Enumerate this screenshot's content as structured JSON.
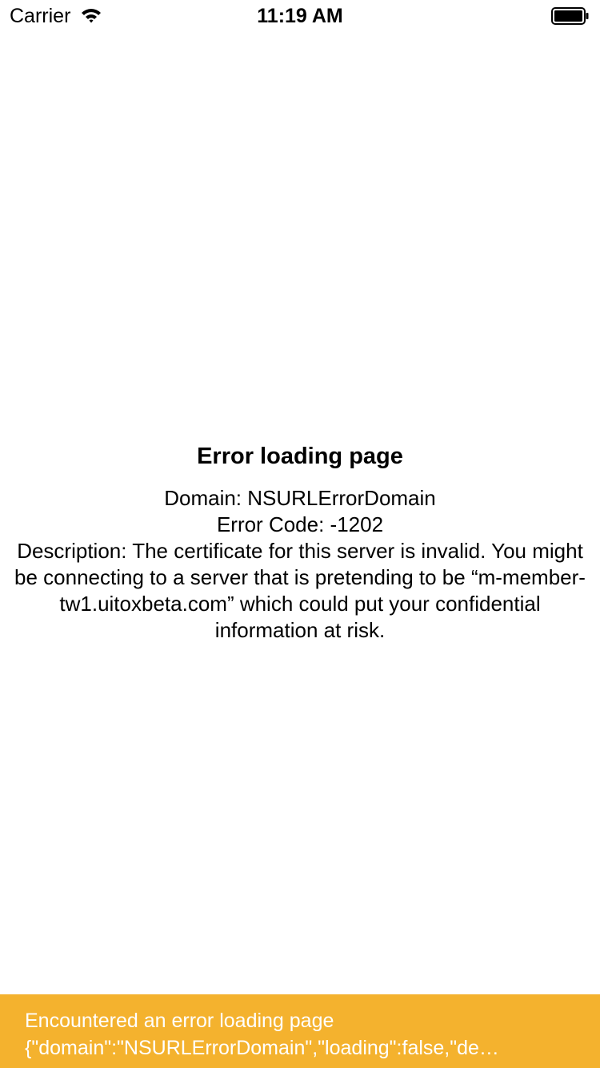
{
  "status_bar": {
    "carrier": "Carrier",
    "time": "11:19 AM",
    "icons": [
      "wifi-icon",
      "battery-icon"
    ]
  },
  "error": {
    "title": "Error loading page",
    "domain": "Domain: NSURLErrorDomain",
    "code": "Error Code: -1202",
    "description": "Description: The certificate for this server is invalid. You might be connecting to a server that is pretending to be “m-member-tw1.uitoxbeta.com” which could put your confidential information at risk."
  },
  "banner": {
    "line1": "Encountered an error loading page",
    "line2": "{\"domain\":\"NSURLErrorDomain\",\"loading\":false,\"de…",
    "color": "#F4B22E"
  }
}
